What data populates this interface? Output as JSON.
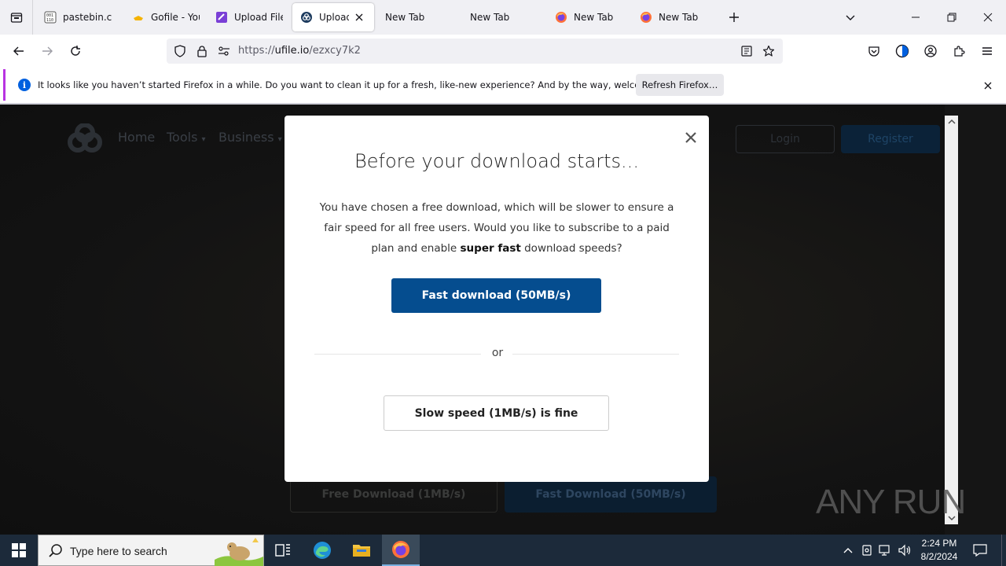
{
  "browser": {
    "tabs": [
      {
        "label": "pastebin.com",
        "favicon": "pastebin-icon"
      },
      {
        "label": "Gofile - Your",
        "favicon": "gofile-icon"
      },
      {
        "label": "Upload Files",
        "favicon": "upload-purple-icon"
      },
      {
        "label": "Upload f",
        "favicon": "ufile-icon",
        "active": true
      },
      {
        "label": "New Tab",
        "favicon": ""
      },
      {
        "label": "New Tab",
        "favicon": ""
      },
      {
        "label": "New Tab",
        "favicon": "firefox-icon"
      },
      {
        "label": "New Tab",
        "favicon": "firefox-icon"
      }
    ],
    "url": {
      "scheme": "https://",
      "host": "ufile.io",
      "path": "/ezxcy7k2"
    },
    "notification": {
      "message": "It looks like you haven’t started Firefox in a while. Do you want to clean it up for a fresh, like-new experience? And by the way, welcome back!",
      "button": "Refresh Firefox…"
    },
    "accent_color": "#b833e1"
  },
  "site": {
    "nav": {
      "home": "Home",
      "tools": "Tools",
      "business": "Business"
    },
    "login": "Login",
    "register": "Register",
    "free_download": "Free Download (1MB/s)",
    "fast_download": "Fast Download (50MB/s)"
  },
  "modal": {
    "title": "Before your download starts...",
    "body_pre": "You have chosen a free download, which will be slower to ensure a fair speed for all free users. Would you like to subscribe to a paid plan and enable",
    "body_bold": "super fast",
    "body_post": "download speeds?",
    "fast_button": "Fast download (50MB/s)",
    "or": "or",
    "slow_button": "Slow speed (1MB/s) is fine",
    "primary_color": "#054d8f"
  },
  "watermark": {
    "text": "ANY RUN"
  },
  "taskbar": {
    "search_placeholder": "Type here to search",
    "time": "2:24 PM",
    "date": "8/2/2024"
  }
}
